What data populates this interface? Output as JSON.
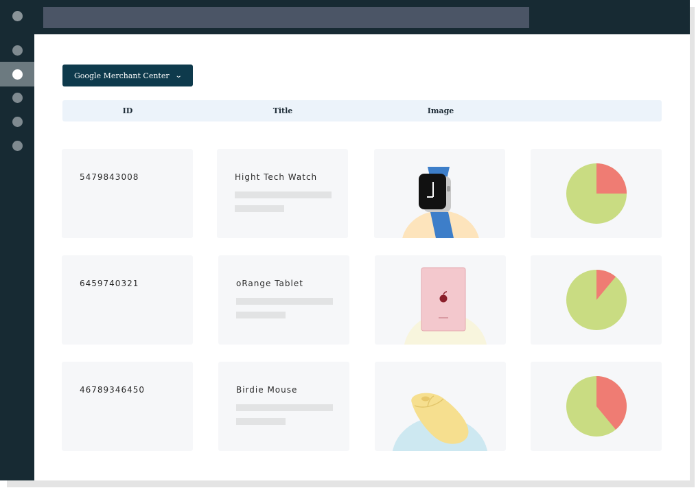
{
  "toolbar": {
    "merchant_label": "Google Merchant Center"
  },
  "table": {
    "columns": [
      "ID",
      "Title",
      "Image"
    ],
    "rows": [
      {
        "id": "5479843008",
        "title": "Hight Tech Watch",
        "pie_fraction": 0.25
      },
      {
        "id": "6459740321",
        "title": "oRange Tablet",
        "pie_fraction": 0.11
      },
      {
        "id": "46789346450",
        "title": "Birdie Mouse",
        "pie_fraction": 0.39
      }
    ]
  },
  "colors": {
    "sidebar": "#172a33",
    "button": "#0e3a4c",
    "pie_base": "#c9dc82",
    "pie_slice": "#ef7c73",
    "watch_blob": "#fde4bc",
    "tablet_blob": "#f8f5dd",
    "mouse_blob": "#cde8f1"
  }
}
